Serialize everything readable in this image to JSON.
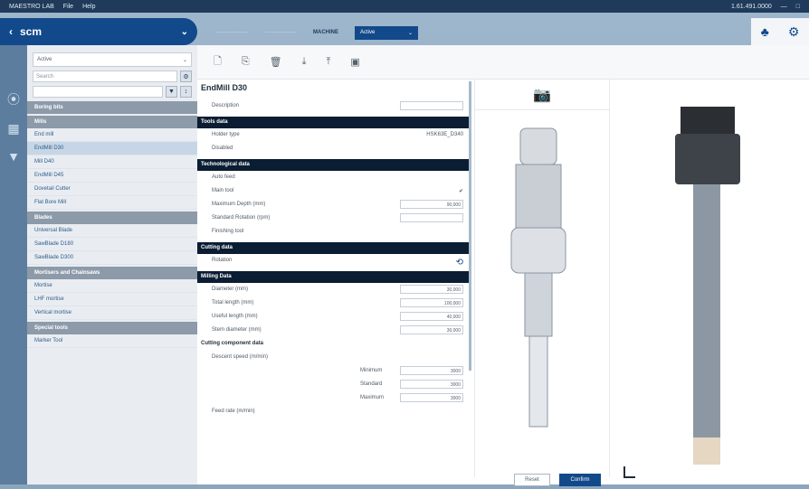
{
  "titlebar": {
    "app": "MAESTRO LAB",
    "menu_file": "File",
    "menu_help": "Help",
    "user": "1.61.491.0000",
    "min": "—",
    "max": "□"
  },
  "brand": {
    "logo": "scm",
    "back": "‹",
    "chev": "⌄"
  },
  "tabs": {
    "t1": "——————",
    "t2": "——————",
    "active": "MACHINE",
    "select": "Active"
  },
  "top_icons": {
    "a": "tools-icon",
    "b": "gear-icon"
  },
  "sidebar": {
    "select_value": "Active",
    "search_placeholder": "Search",
    "sections": [
      {
        "label": "Boring bits",
        "rows": []
      },
      {
        "label": "Mills",
        "rows": [
          {
            "label": "End mill",
            "sel": false
          },
          {
            "label": "EndMill D30",
            "sel": true
          },
          {
            "label": "Mill D40",
            "sel": false
          },
          {
            "label": "EndMill D45",
            "sel": false
          },
          {
            "label": "Dovetail Cutter",
            "sel": false
          },
          {
            "label": "Flat Bore Mill",
            "sel": false
          }
        ]
      },
      {
        "label": "Blades",
        "rows": [
          {
            "label": "Universal Blade",
            "sel": false
          },
          {
            "label": "SawBlade D180",
            "sel": false
          },
          {
            "label": "SawBlade D300",
            "sel": false
          }
        ]
      },
      {
        "label": "Mortisers and Chainsaws",
        "rows": [
          {
            "label": "Mortise",
            "sel": false
          },
          {
            "label": "LHF mortise",
            "sel": false
          },
          {
            "label": "Vertical mortise",
            "sel": false
          }
        ]
      },
      {
        "label": "Special tools",
        "rows": [
          {
            "label": "Marker Tool",
            "sel": false
          }
        ]
      }
    ]
  },
  "form": {
    "title": "EndMill D30",
    "description_label": "Description",
    "sec_tool": "Tools data",
    "holder_type": "Holder type",
    "holder_value": "HSK63E_D340",
    "disabled": "Disabled",
    "sec_tech": "Technological data",
    "auto_feed": "Auto feed",
    "main_tool": "Main tool",
    "max_depth": "Maximum Depth (mm)",
    "max_depth_val": "90,000",
    "std_rotation": "Standard Rotation (rpm)",
    "finishing": "Finishing tool",
    "sec_cut": "Cutting data",
    "rotation": "Rotation",
    "sec_milling": "Milling Data",
    "diameter": "Diameter (mm)",
    "diameter_val": "30,000",
    "total_length": "Total length (mm)",
    "total_length_val": "100,000",
    "useful_length": "Useful length (mm)",
    "useful_length_val": "40,000",
    "stem_diameter": "Stem diameter (mm)",
    "stem_diameter_val": "30,000",
    "sec_component": "Cutting component data",
    "descent_speed": "Descent speed (m/min)",
    "min": "Minimum",
    "std": "Standard",
    "max": "Maximum",
    "min_val": "3000",
    "std_val": "3000",
    "max_val": "3000",
    "feed_rate": "Feed rate (m/min)"
  },
  "buttons": {
    "reset": "Reset",
    "confirm": "Confirm"
  }
}
